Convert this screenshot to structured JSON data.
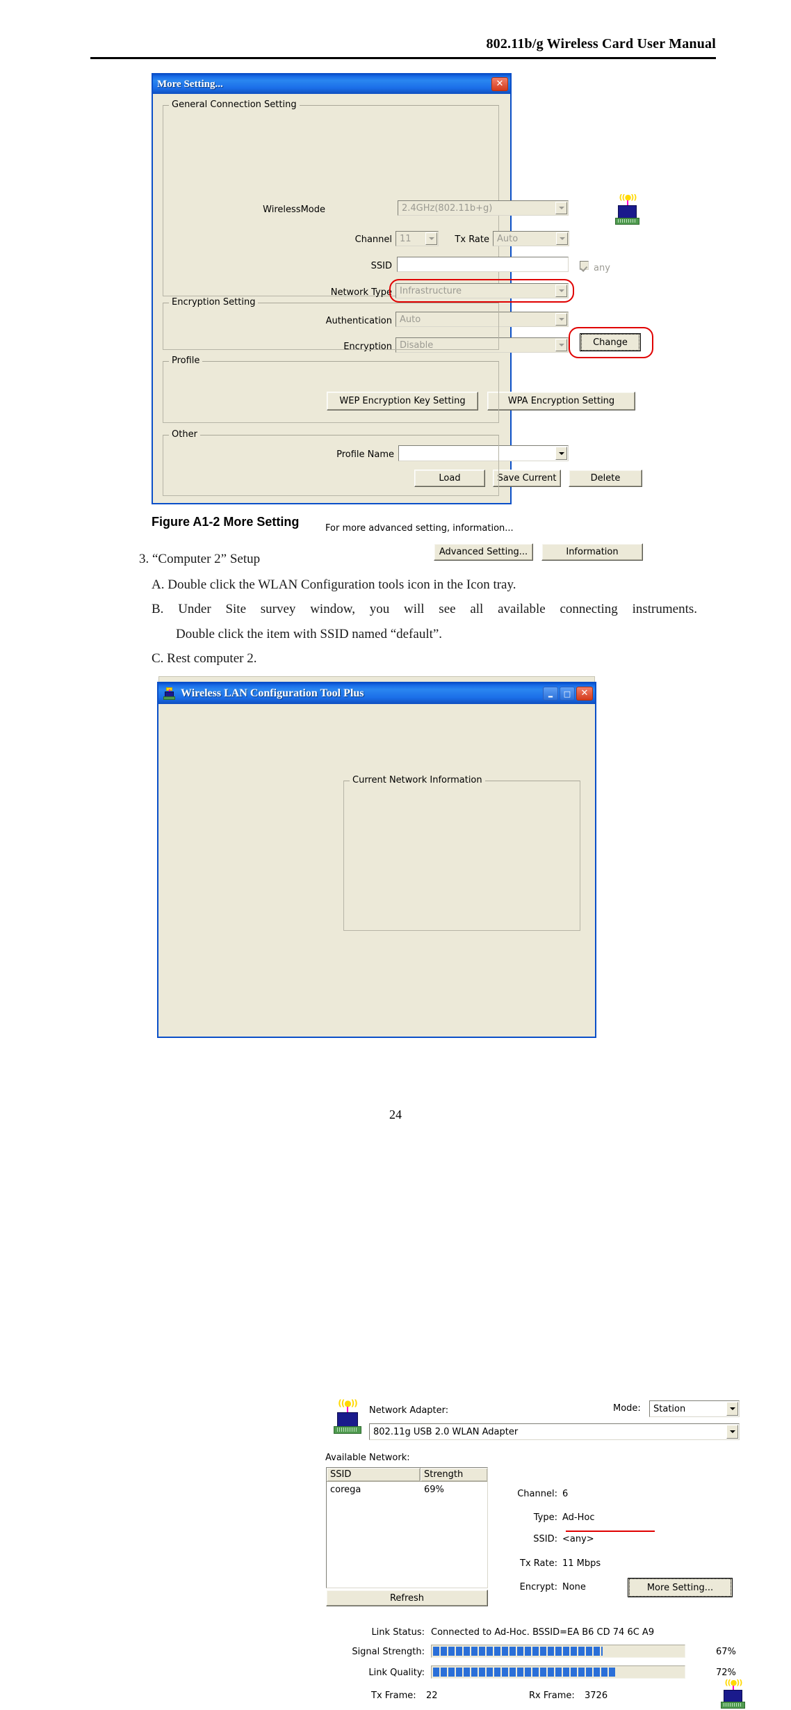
{
  "page": {
    "header_title": "802.11b/g Wireless Card User Manual",
    "page_number": "24"
  },
  "more_setting_dialog": {
    "title": "More Setting...",
    "close_glyph": "✕",
    "general": {
      "legend": "General Connection Setting",
      "wireless_mode_label": "WirelessMode",
      "wireless_mode_value": "2.4GHz(802.11b+g)",
      "channel_label": "Channel",
      "channel_value": "11",
      "tx_rate_label": "Tx Rate",
      "tx_rate_value": "Auto",
      "ssid_label": "SSID",
      "ssid_value": "",
      "any_label": "any",
      "network_type_label": "Network Type",
      "network_type_value": "Infrastructure",
      "authentication_label": "Authentication",
      "authentication_value": "Auto",
      "encryption_label": "Encryption",
      "encryption_value": "Disable",
      "change_button": "Change"
    },
    "encryption_setting": {
      "legend": "Encryption Setting",
      "wep_button": "WEP Encryption Key Setting",
      "wpa_button": "WPA Encryption Setting"
    },
    "profile": {
      "legend": "Profile",
      "profile_name_label": "Profile Name",
      "profile_name_value": "",
      "load_button": "Load",
      "save_current_button": "Save Current",
      "delete_button": "Delete"
    },
    "other": {
      "legend": "Other",
      "text": "For more advanced setting, information...",
      "advanced_setting_button": "Advanced Setting...",
      "information_button": "Information"
    }
  },
  "figure_caption": "Figure A1-2 More Setting",
  "instructions": {
    "step3": "3. “Computer 2” Setup",
    "a": "A.  Double click the WLAN Configuration tools icon in the Icon tray.",
    "b_line1": "B.  Under Site survey window, you will see all available connecting instruments.",
    "b_line2": "Double click the item   with SSID named “default”.",
    "c": "C.  Rest computer 2."
  },
  "wlan_tool_dialog": {
    "title": "Wireless LAN Configuration Tool Plus",
    "minimize_glyph": "–",
    "maximize_glyph": "□",
    "close_glyph": "✕",
    "network_adapter_label": "Network Adapter:",
    "network_adapter_value": "802.11g USB 2.0 WLAN Adapter",
    "mode_label": "Mode:",
    "mode_value": "Station",
    "available_network_label": "Available Network:",
    "columns": [
      "SSID",
      "Strength"
    ],
    "rows": [
      {
        "ssid": "corega",
        "strength": "69%"
      }
    ],
    "refresh_button": "Refresh",
    "current_network": {
      "legend": "Current Network Information",
      "channel_label": "Channel:",
      "channel_value": "6",
      "type_label": "Type:",
      "type_value": "Ad-Hoc",
      "ssid_label": "SSID:",
      "ssid_value": "<any>",
      "tx_rate_label": "Tx Rate:",
      "tx_rate_value": "11 Mbps",
      "encrypt_label": "Encrypt:",
      "encrypt_value": "None",
      "more_setting_button": "More Setting..."
    },
    "status": {
      "link_status_label": "Link Status:",
      "link_status_value": "Connected to Ad-Hoc. BSSID=EA B6 CD 74 6C A9",
      "signal_strength_label": "Signal Strength:",
      "signal_strength_value": "67%",
      "signal_strength_percent": 67,
      "link_quality_label": "Link Quality:",
      "link_quality_value": "72%",
      "link_quality_percent": 72,
      "tx_frame_label": "Tx Frame:",
      "tx_frame_value": "22",
      "rx_frame_label": "Rx Frame:",
      "rx_frame_value": "3726"
    }
  },
  "colors": {
    "titlebar_blue": "#1b6ee8",
    "dialog_face": "#ece9d8",
    "highlight_red": "#e00000",
    "progress_blue": "#2a6fd8"
  }
}
